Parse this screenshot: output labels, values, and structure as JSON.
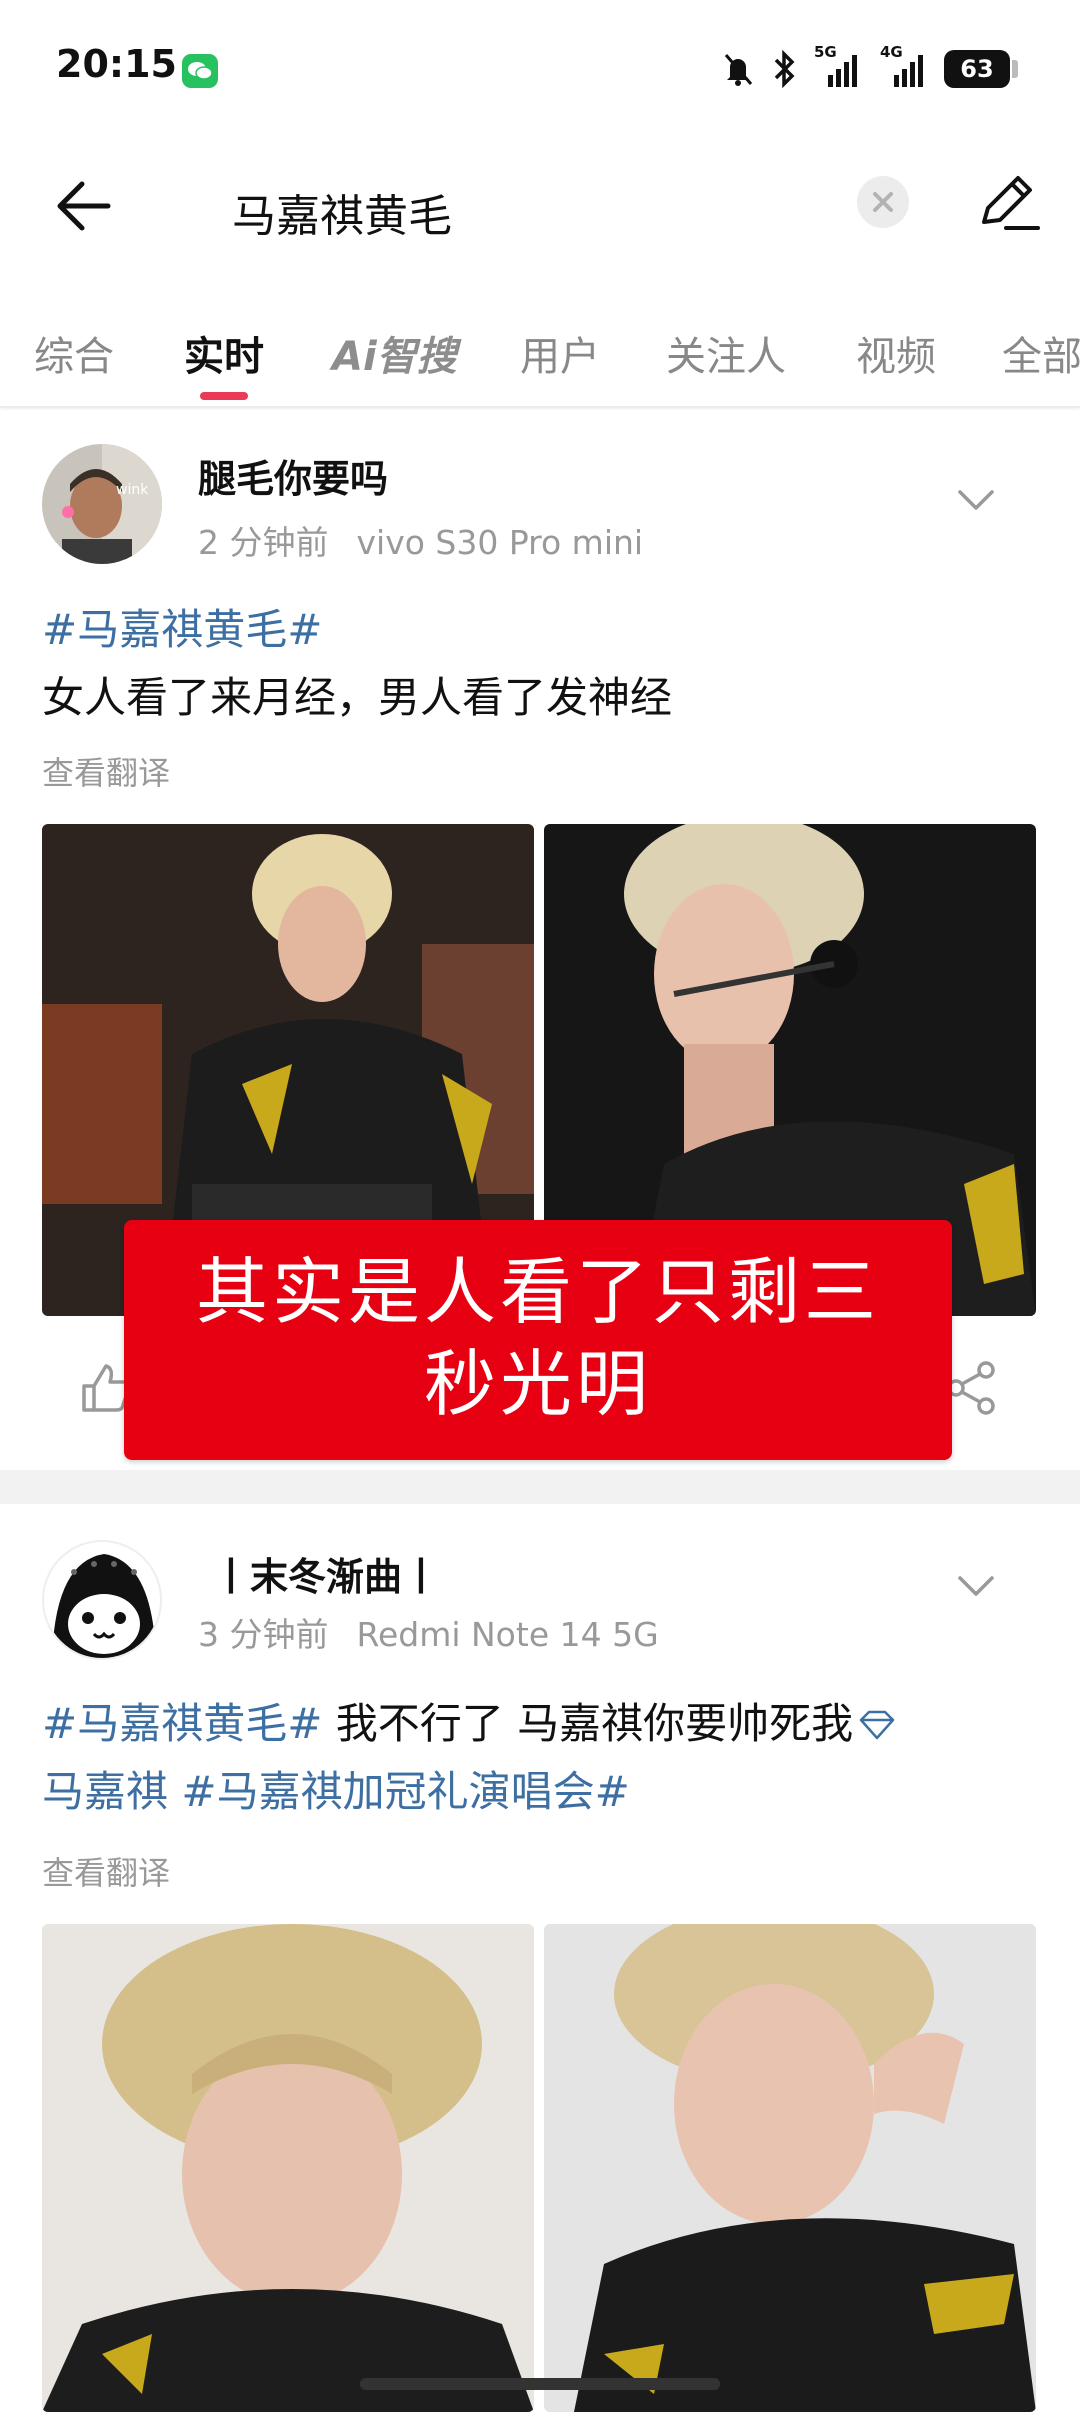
{
  "status_bar": {
    "time": "20:15",
    "network_1": "5G",
    "network_2": "4G",
    "battery": "63"
  },
  "search": {
    "query": "马嘉祺黄毛"
  },
  "tabs": [
    {
      "label": "综合"
    },
    {
      "label": "实时"
    },
    {
      "label": "Ai智搜"
    },
    {
      "label": "用户"
    },
    {
      "label": "关注人"
    },
    {
      "label": "视频"
    },
    {
      "label": "全部"
    }
  ],
  "posts": [
    {
      "username": "腿毛你要吗",
      "time": "2 分钟前",
      "device": "vivo S30 Pro mini",
      "avatar_badge": "wink",
      "hashtag": "#马嘉祺黄毛#",
      "text": "女人看了来月经，男人看了发神经",
      "translate": "查看翻译"
    },
    {
      "username": "丨末冬渐曲丨",
      "time": "3 分钟前",
      "device": "Redmi Note 14 5G",
      "hashtag_1": "#马嘉祺黄毛#",
      "text_1": " 我不行了 马嘉祺你要帅死我",
      "mention": "马嘉祺",
      "hashtag_2": "#马嘉祺加冠礼演唱会#",
      "translate": "查看翻译"
    }
  ],
  "banner": {
    "line1": "其实是人看了只剩三",
    "line2": "秒光明"
  },
  "colors": {
    "accent": "#ea3a57",
    "hashtag": "#3d6fa3",
    "banner": "#e60012"
  }
}
